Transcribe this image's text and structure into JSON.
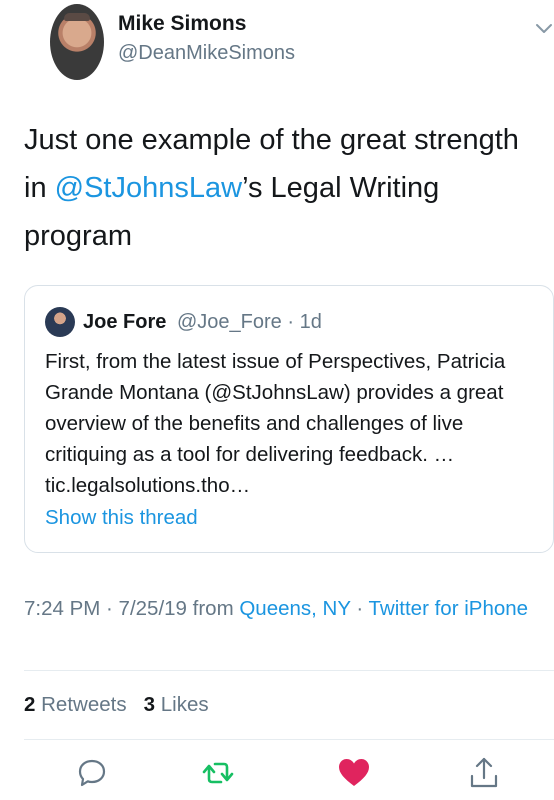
{
  "author": {
    "name": "Mike Simons",
    "handle": "@DeanMikeSimons"
  },
  "tweet": {
    "text_before": "Just one example of the great strength in ",
    "mention": "@StJohnsLaw",
    "text_after": "’s Legal Writing program"
  },
  "quoted": {
    "name": "Joe Fore",
    "handle_time": "@Joe_Fore · 1d",
    "text": "First, from the latest issue of Perspectives, Patricia Grande Montana (@StJohnsLaw) provides a great overview of the benefits and challenges of live critiquing as a tool for delivering feedback. …tic.legalsolutions.tho…",
    "show_thread": "Show this thread"
  },
  "meta": {
    "time_date": "7:24 PM · 7/25/19 from ",
    "location": "Queens, NY",
    "separator": " · ",
    "source": "Twitter for iPhone"
  },
  "stats": {
    "retweets_count": "2",
    "retweets_label": "Retweets",
    "likes_count": "3",
    "likes_label": "Likes"
  },
  "colors": {
    "link": "#1b95e0",
    "retweet": "#17bf63",
    "like": "#e0245e",
    "icon_gray": "#657786"
  },
  "icons": [
    "chevron-down-icon",
    "reply-icon",
    "retweet-icon",
    "like-icon",
    "share-icon"
  ]
}
